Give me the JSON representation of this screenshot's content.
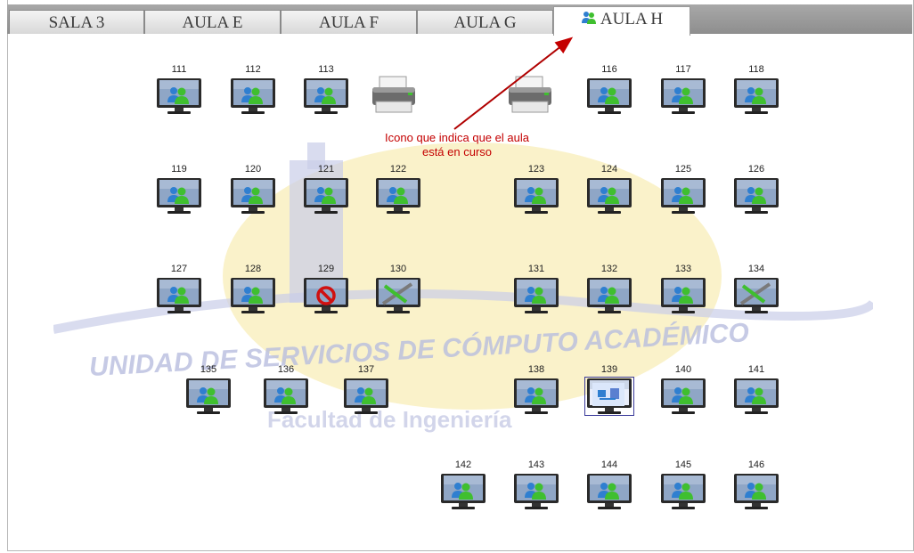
{
  "tabs": [
    {
      "label": "SALA 3",
      "active": false
    },
    {
      "label": "AULA E",
      "active": false
    },
    {
      "label": "AULA F",
      "active": false
    },
    {
      "label": "AULA G",
      "active": false
    },
    {
      "label": "AULA H",
      "active": true,
      "icon": "users-icon"
    }
  ],
  "watermark": {
    "line1": "UNIDAD DE SERVICIOS DE CÓMPUTO ACADÉMICO",
    "line2": "Facultad de Ingeniería"
  },
  "annotation": {
    "text_line1": "Icono que indica que el aula",
    "text_line2": "está en curso",
    "color": "#c40000"
  },
  "workstations": [
    {
      "id": "111",
      "status": "users"
    },
    {
      "id": "112",
      "status": "users"
    },
    {
      "id": "113",
      "status": "users"
    },
    {
      "id": "116",
      "status": "users"
    },
    {
      "id": "117",
      "status": "users"
    },
    {
      "id": "118",
      "status": "users"
    },
    {
      "id": "119",
      "status": "users"
    },
    {
      "id": "120",
      "status": "users"
    },
    {
      "id": "121",
      "status": "users"
    },
    {
      "id": "122",
      "status": "users"
    },
    {
      "id": "123",
      "status": "users"
    },
    {
      "id": "124",
      "status": "users"
    },
    {
      "id": "125",
      "status": "users"
    },
    {
      "id": "126",
      "status": "users"
    },
    {
      "id": "127",
      "status": "users"
    },
    {
      "id": "128",
      "status": "users"
    },
    {
      "id": "129",
      "status": "blocked"
    },
    {
      "id": "130",
      "status": "maintenance"
    },
    {
      "id": "131",
      "status": "users"
    },
    {
      "id": "132",
      "status": "users"
    },
    {
      "id": "133",
      "status": "users"
    },
    {
      "id": "134",
      "status": "maintenance"
    },
    {
      "id": "135",
      "status": "users"
    },
    {
      "id": "136",
      "status": "users"
    },
    {
      "id": "137",
      "status": "users"
    },
    {
      "id": "138",
      "status": "users"
    },
    {
      "id": "139",
      "status": "network"
    },
    {
      "id": "140",
      "status": "users"
    },
    {
      "id": "141",
      "status": "users"
    },
    {
      "id": "142",
      "status": "users"
    },
    {
      "id": "143",
      "status": "users"
    },
    {
      "id": "144",
      "status": "users"
    },
    {
      "id": "145",
      "status": "users"
    },
    {
      "id": "146",
      "status": "users"
    }
  ],
  "printers": [
    {
      "icon": "printer-icon"
    },
    {
      "icon": "printer-icon"
    }
  ],
  "colors": {
    "tabbar": "#9a9a9a",
    "users_green": "#3fbf2f",
    "users_blue": "#2f7fd0",
    "blocked_red": "#d01010"
  }
}
